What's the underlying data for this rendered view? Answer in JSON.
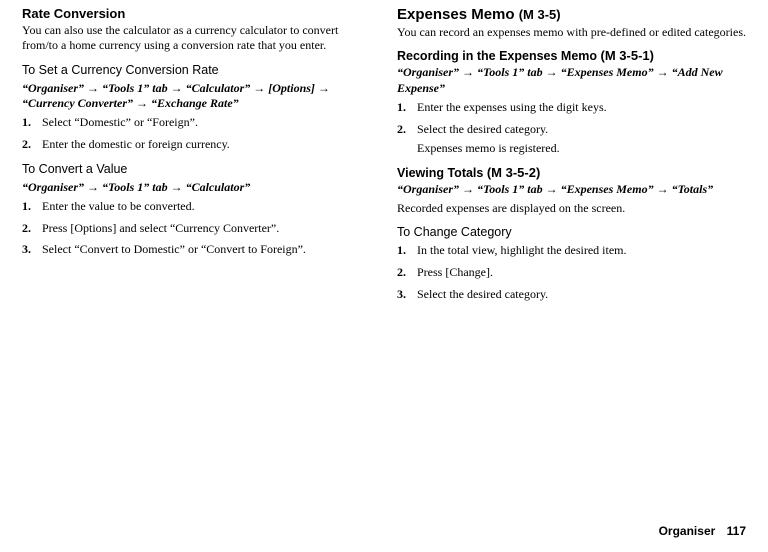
{
  "left": {
    "h3": "Rate Conversion",
    "intro": "You can also use the calculator as a currency calculator to convert from/to a home currency using a conversion rate that you enter.",
    "sub1": "To Set a Currency Conversion Rate",
    "nav1": "“Organiser” → “Tools 1” tab → “Calculator” → [Options] → “Currency Converter” → “Exchange Rate”",
    "s1_1": "Select “Domestic” or “Foreign”.",
    "s1_2": "Enter the domestic or foreign currency.",
    "sub2": "To Convert a Value",
    "nav2": "“Organiser” → “Tools 1” tab → “Calculator”",
    "s2_1": "Enter the value to be converted.",
    "s2_2": "Press [Options] and select “Currency Converter”.",
    "s2_3": "Select “Convert to Domestic” or “Convert to Foreign”."
  },
  "right": {
    "h2": "Expenses Memo",
    "h2code": "(M 3-5)",
    "intro": "You can record an expenses memo with pre-defined or edited categories.",
    "h4a": "Recording in the Expenses Memo",
    "h4acode": "(M 3-5-1)",
    "navA": "“Organiser” → “Tools 1” tab → “Expenses Memo” → “Add New Expense”",
    "a1": "Enter the expenses using the digit keys.",
    "a2": "Select the desired category.",
    "a2note": "Expenses memo is registered.",
    "h4b": "Viewing Totals",
    "h4bcode": "(M 3-5-2)",
    "navB": "“Organiser” → “Tools 1” tab → “Expenses Memo” → “Totals”",
    "bdesc": "Recorded expenses are displayed on the screen.",
    "subC": "To Change Category",
    "c1": "In the total view, highlight the desired item.",
    "c2": "Press [Change].",
    "c3": "Select the desired category."
  },
  "footer": {
    "section": "Organiser",
    "page": "117"
  }
}
